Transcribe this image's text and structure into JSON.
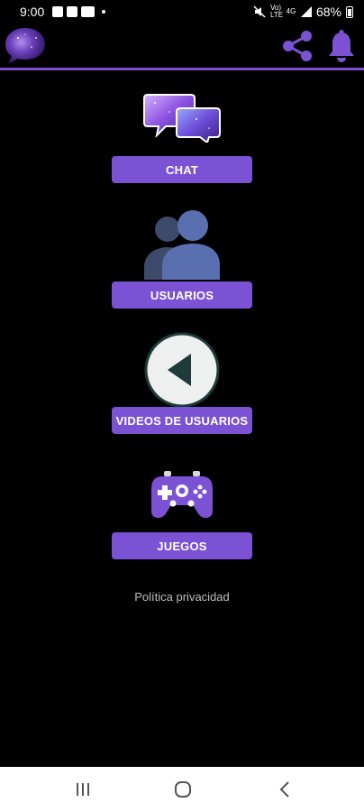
{
  "status_bar": {
    "time": "9:00",
    "network_top": "Vo)",
    "network_bottom": "LTE",
    "network_type": "4G",
    "battery": "68%"
  },
  "header": {
    "accent_color": "#7a4fd1"
  },
  "menu": {
    "chat_label": "CHAT",
    "users_label": "USUARIOS",
    "videos_label": "VIDEOS DE USUARIOS",
    "games_label": "JUEGOS",
    "button_color": "#7b52d3"
  },
  "footer": {
    "privacy_label": "Política privacidad"
  }
}
